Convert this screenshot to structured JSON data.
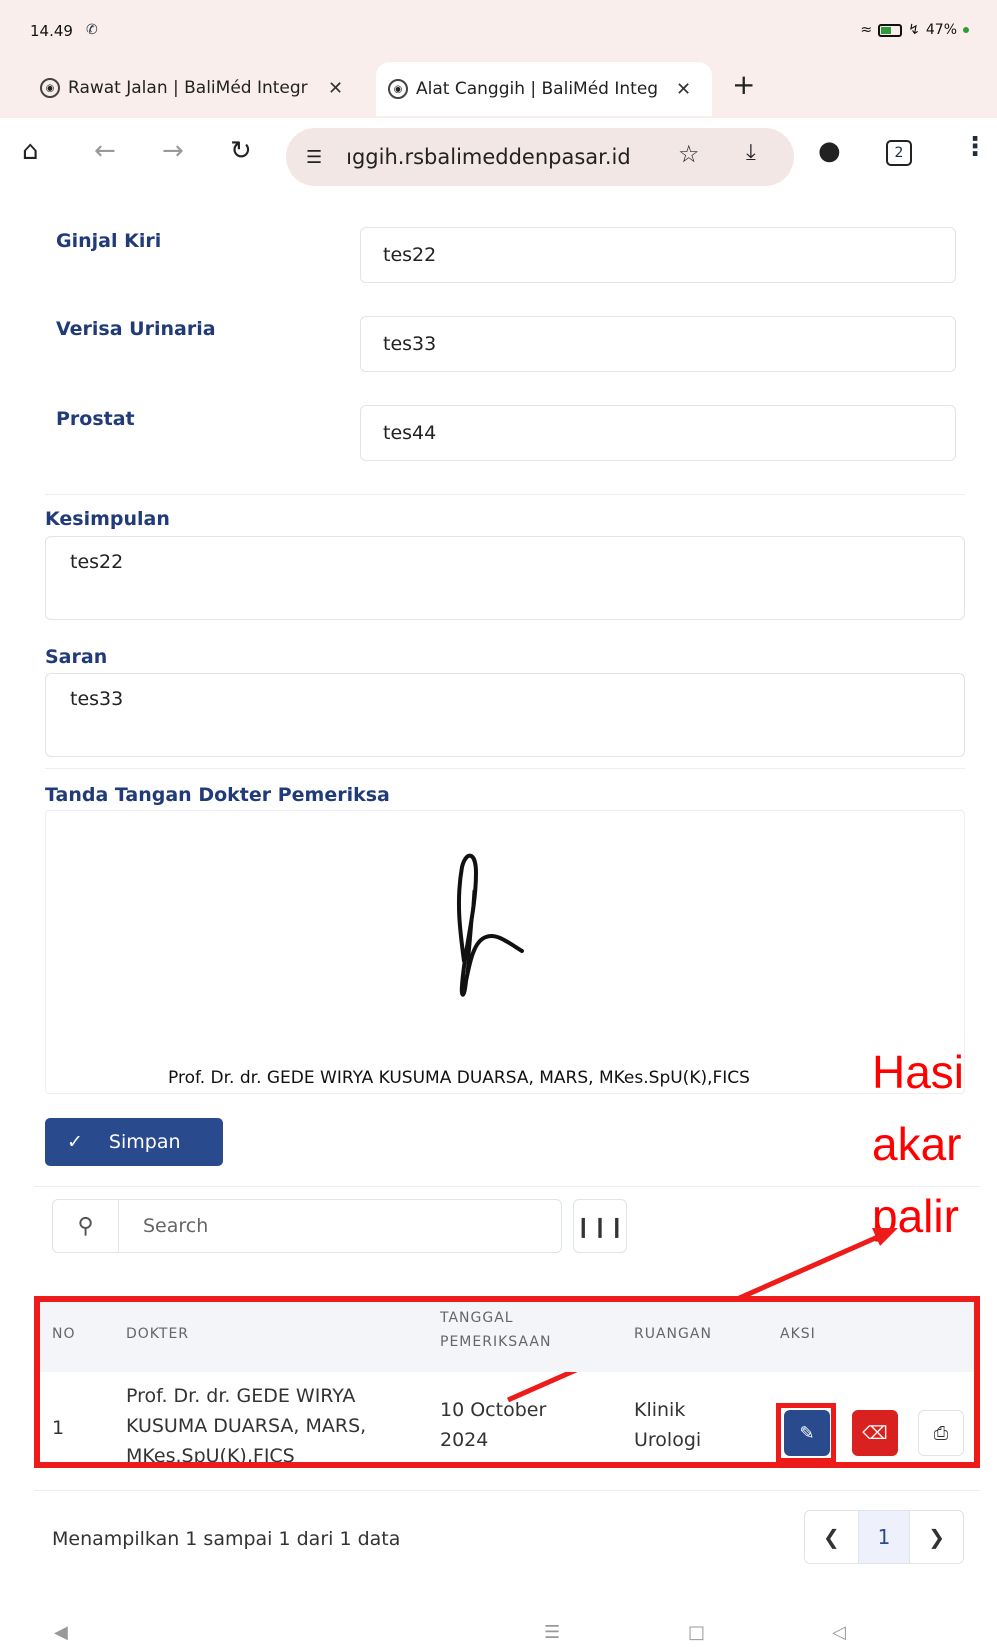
{
  "status": {
    "time": "14.49",
    "battery": "47%"
  },
  "tabs": [
    {
      "title": "Rawat Jalan | BaliMéd Integr"
    },
    {
      "title": "Alat Canggih | BaliMéd Integ"
    }
  ],
  "toolbar": {
    "url": "ıggih.rsbalimeddenpasar.id",
    "tab_count": "2"
  },
  "form": {
    "fields": [
      {
        "label": "Ginjal Kiri",
        "value": "tes22"
      },
      {
        "label": "Verisa Urinaria",
        "value": "tes33"
      },
      {
        "label": "Prostat",
        "value": "tes44"
      }
    ],
    "kesimpulan": {
      "label": "Kesimpulan",
      "value": "tes22"
    },
    "saran": {
      "label": "Saran",
      "value": "tes33"
    },
    "signature": {
      "label": "Tanda Tangan Dokter Pemeriksa",
      "doctor_name": "Prof. Dr. dr. GEDE WIRYA KUSUMA DUARSA, MARS, MKes.SpU(K),FICS"
    },
    "save_label": "Simpan"
  },
  "annotation": {
    "lines": [
      "Hasi",
      "akar",
      "palir"
    ],
    "color": "#ff0000"
  },
  "search": {
    "placeholder": "Search"
  },
  "table": {
    "headers": {
      "no": "NO",
      "dokter": "DOKTER",
      "tanggal_1": "TANGGAL",
      "tanggal_2": "PEMERIKSAAN",
      "ruangan": "RUANGAN",
      "aksi": "AKSI"
    },
    "rows": [
      {
        "no": "1",
        "dokter_1": "Prof. Dr. dr. GEDE WIRYA",
        "dokter_2": "KUSUMA DUARSA, MARS,",
        "dokter_3": "MKes.SpU(K),FICS",
        "tanggal_1": "10 October",
        "tanggal_2": "2024",
        "ruangan_1": "Klinik",
        "ruangan_2": "Urologi"
      }
    ]
  },
  "pagination": {
    "showing": "Menampilkan 1 sampai 1 dari 1 data",
    "page": "1"
  },
  "colors": {
    "primary": "#2a4a8e",
    "danger": "#d9221f",
    "label": "#213a78",
    "highlight": "#ee1b1b"
  }
}
